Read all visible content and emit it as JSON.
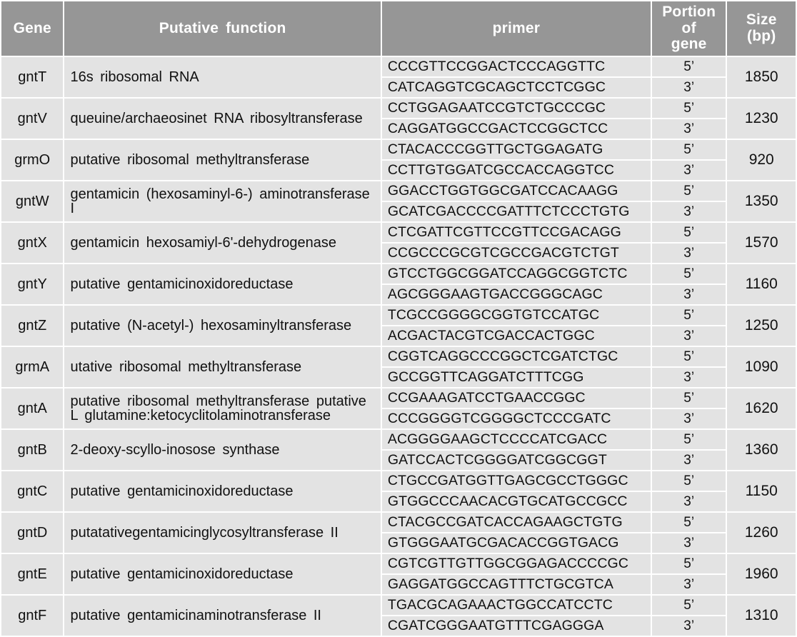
{
  "table": {
    "columns": [
      {
        "key": "gene",
        "label": "Gene"
      },
      {
        "key": "func",
        "label": "Putative  function"
      },
      {
        "key": "primer",
        "label": "primer"
      },
      {
        "key": "portion",
        "label_line1": "Portion  of",
        "label_line2": "gene"
      },
      {
        "key": "size",
        "label": "Size  (bp)"
      }
    ],
    "portion_labels": {
      "five_prime": "5’",
      "three_prime": "3’"
    },
    "colors": {
      "header_background": "#969696",
      "header_text": "#ffffff",
      "cell_background": "#e3e3e3",
      "cell_text": "#111111",
      "page_background": "#ffffff"
    },
    "rows": [
      {
        "gene": "gntT",
        "function_lines": [
          "16s  ribosomal  RNA"
        ],
        "primer_5": "CCCGTTCCGGACTCCCAGGTTC",
        "primer_3": "CATCAGGTCGCAGCTCCTCGGC",
        "portion_5": "5’",
        "portion_3": "3’",
        "size": "1850"
      },
      {
        "gene": "gntV",
        "function_lines": [
          "queuine/archaeosinet  RNA  ribosyltransferase"
        ],
        "primer_5": "CCTGGAGAATCCGTCTGCCCGC",
        "primer_3": "CAGGATGGCCGACTCCGGCTCC",
        "portion_5": "5’",
        "portion_3": "3’",
        "size": "1230"
      },
      {
        "gene": "grmO",
        "function_lines": [
          "putative  ribosomal  methyltransferase"
        ],
        "primer_5": "CTACACCCGGTTGCTGGAGATG",
        "primer_3": "CCTTGTGGATCGCCACCAGGTCC",
        "portion_5": "5’",
        "portion_3": "3’",
        "size": "920"
      },
      {
        "gene": "gntW",
        "function_lines": [
          "gentamicin  (hexosaminyl-6-)  aminotransferase",
          "I"
        ],
        "primer_5": "GGACCTGGTGGCGATCCACAAGG",
        "primer_3": "GCATCGACCCCGATTTCTCCCTGTG",
        "portion_5": "5’",
        "portion_3": "3’",
        "size": "1350"
      },
      {
        "gene": "gntX",
        "function_lines": [
          "gentamicin  hexosamiyl-6'-dehydrogenase"
        ],
        "primer_5": "CTCGATTCGTTCCGTTCCGACAGG",
        "primer_3": "CCGCCCGCGTCGCCGACGTCTGT",
        "portion_5": "5’",
        "portion_3": "3’",
        "size": "1570"
      },
      {
        "gene": "gntY",
        "function_lines": [
          "putative  gentamicinoxidoreductase"
        ],
        "primer_5": "GTCCTGGCGGATCCAGGCGGTCTC",
        "primer_3": "AGCGGGAAGTGACCGGGCAGC",
        "portion_5": "5’",
        "portion_3": "3’",
        "size": "1160"
      },
      {
        "gene": "gntZ",
        "function_lines": [
          "putative  (N-acetyl-)  hexosaminyltransferase"
        ],
        "primer_5": "TCGCCGGGGCGGTGTCCATGC",
        "primer_3": "ACGACTACGTCGACCACTGGC",
        "portion_5": "5’",
        "portion_3": "3’",
        "size": "1250"
      },
      {
        "gene": "grmA",
        "function_lines": [
          "utative  ribosomal  methyltransferase"
        ],
        "primer_5": "CGGTCAGGCCCGGCTCGATCTGC",
        "primer_3": "GCCGGTTCAGGATCTTTCGG",
        "portion_5": "5’",
        "portion_3": "3’",
        "size": "1090"
      },
      {
        "gene": "gntA",
        "function_lines": [
          "putative  ribosomal  methyltransferase  putative",
          "L  glutamine:ketocyclitolaminotransferase"
        ],
        "primer_5": "CCGAAAGATCCTGAACCGGC",
        "primer_3": "CCCGGGGTCGGGGCTCCCGATC",
        "portion_5": "5’",
        "portion_3": "3’",
        "size": "1620"
      },
      {
        "gene": "gntB",
        "function_lines": [
          "2-deoxy-scyllo-inosose  synthase"
        ],
        "primer_5": "ACGGGGAAGCTCCCCATCGACC",
        "primer_3": "GATCCACTCGGGGATCGGCGGT",
        "portion_5": "5’",
        "portion_3": "3’",
        "size": "1360"
      },
      {
        "gene": "gntC",
        "function_lines": [
          "putative  gentamicinoxidoreductase"
        ],
        "primer_5": "CTGCCGATGGTTGAGCGCCTGGGC",
        "primer_3": "GTGGCCCAACACGTGCATGCCGCC",
        "portion_5": "5’",
        "portion_3": "3’",
        "size": "1150"
      },
      {
        "gene": "gntD",
        "function_lines": [
          "putatativegentamicinglycosyltransferase  II"
        ],
        "primer_5": "CTACGCCGATCACCAGAAGCTGTG",
        "primer_3": "GTGGGAATGCGACACCGGTGACG",
        "portion_5": "5’",
        "portion_3": "3’",
        "size": "1260"
      },
      {
        "gene": "gntE",
        "function_lines": [
          "putative  gentamicinoxidoreductase"
        ],
        "primer_5": "CGTCGTTGTTGGCGGAGACCCCGC",
        "primer_3": "GAGGATGGCCAGTTTCTGCGTCA",
        "portion_5": "5’",
        "portion_3": "3’",
        "size": "1960"
      },
      {
        "gene": "gntF",
        "function_lines": [
          "putative  gentamicinaminotransferase  II",
          ""
        ],
        "primer_5": "TGACGCAGAAACTGGCCATCCTC",
        "primer_3": "CGATCGGGAATGTTTCGAGGGA",
        "portion_5": "5’",
        "portion_3": "3’",
        "size": "1310"
      }
    ]
  }
}
